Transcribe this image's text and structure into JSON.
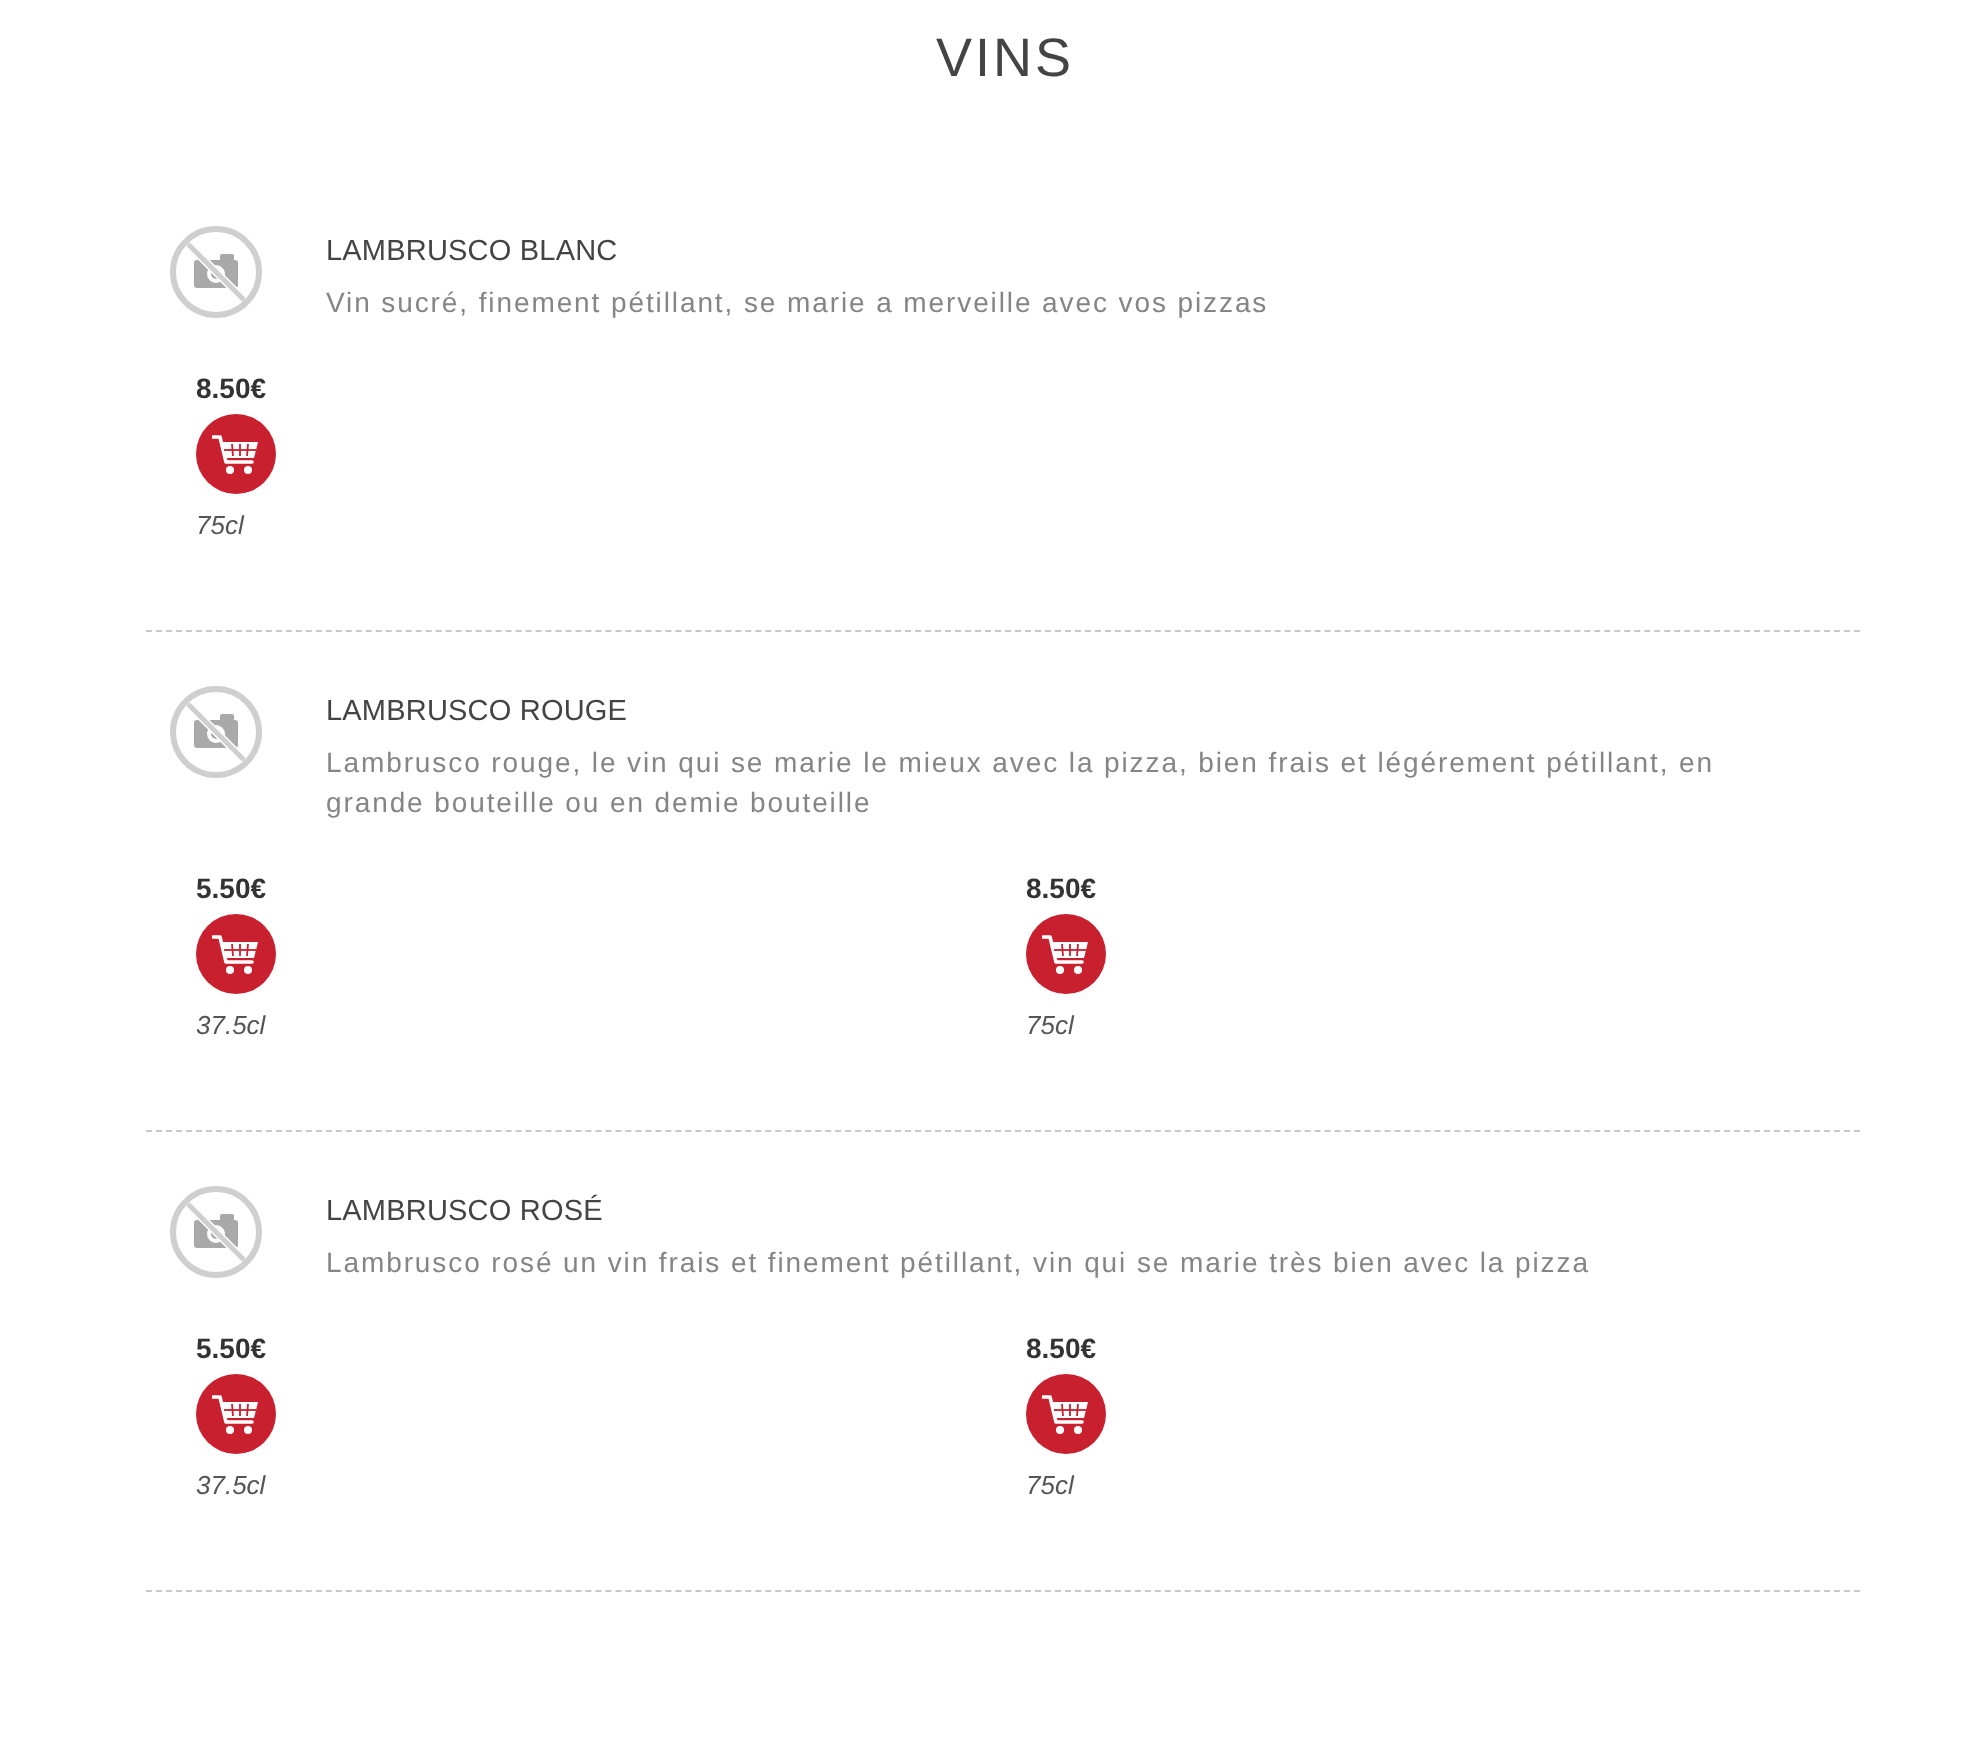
{
  "title": "VINS",
  "wines": [
    {
      "name": "LAMBRUSCO BLANC",
      "description": "Vin sucré, finement pétillant, se marie a merveille avec vos pizzas",
      "variants": [
        {
          "price": "8.50€",
          "size": "75cl"
        }
      ]
    },
    {
      "name": "LAMBRUSCO ROUGE",
      "description": "Lambrusco rouge, le vin qui se marie le mieux avec la pizza, bien frais et légérement pétillant, en grande bouteille ou en demie bouteille",
      "variants": [
        {
          "price": "5.50€",
          "size": "37.5cl"
        },
        {
          "price": "8.50€",
          "size": "75cl"
        }
      ]
    },
    {
      "name": "LAMBRUSCO ROSÉ",
      "description": "Lambrusco rosé un vin frais et finement pétillant, vin qui se marie très bien avec la pizza",
      "variants": [
        {
          "price": "5.50€",
          "size": "37.5cl"
        },
        {
          "price": "8.50€",
          "size": "75cl"
        }
      ]
    }
  ]
}
